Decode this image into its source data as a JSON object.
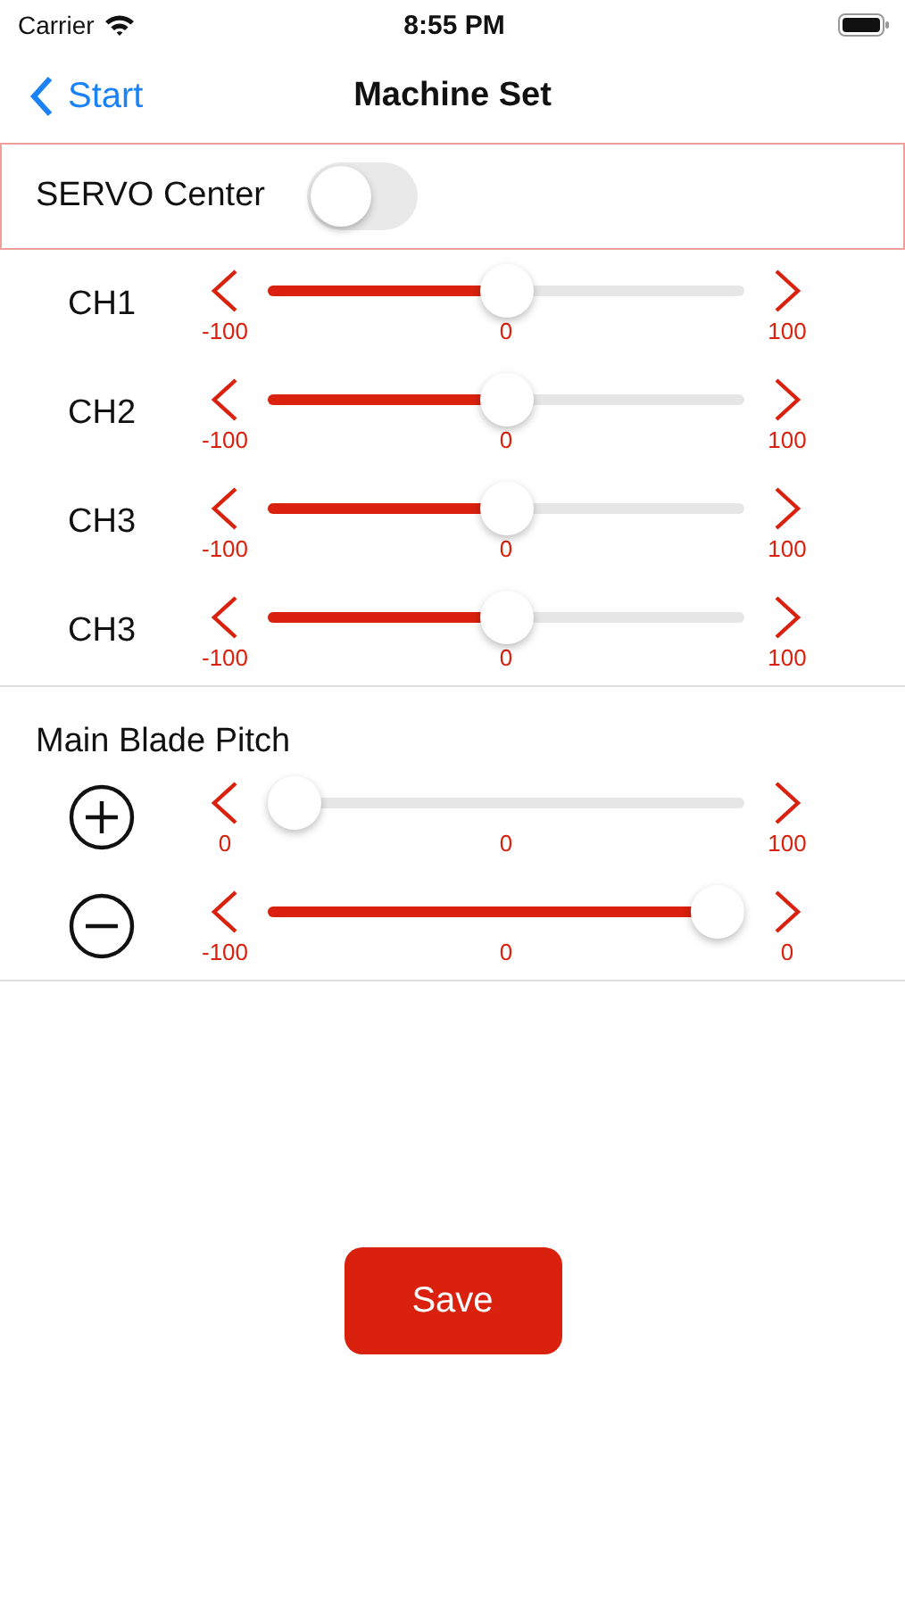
{
  "status_bar": {
    "carrier": "Carrier",
    "time": "8:55 PM"
  },
  "nav": {
    "back": "Start",
    "title": "Machine Set"
  },
  "servo_center": {
    "label": "SERVO Center",
    "on": false
  },
  "channels": [
    {
      "kind": "text",
      "label": "CH1",
      "level": 0.5,
      "min": "-100",
      "mid": "0",
      "max": "100"
    },
    {
      "kind": "text",
      "label": "CH2",
      "level": 0.5,
      "min": "-100",
      "mid": "0",
      "max": "100"
    },
    {
      "kind": "text",
      "label": "CH3",
      "level": 0.5,
      "min": "-100",
      "mid": "0",
      "max": "100"
    },
    {
      "kind": "text",
      "label": "CH3",
      "level": 0.5,
      "min": "-100",
      "mid": "0",
      "max": "100"
    }
  ],
  "main_blade_pitch": {
    "title": "Main Blade Pitch",
    "rows": [
      {
        "kind": "plus",
        "level": 0,
        "min": "0",
        "mid": "0",
        "max": "100"
      },
      {
        "kind": "minus",
        "level": 1,
        "min": "-100",
        "mid": "0",
        "max": "0"
      }
    ]
  },
  "save_button": "Save"
}
